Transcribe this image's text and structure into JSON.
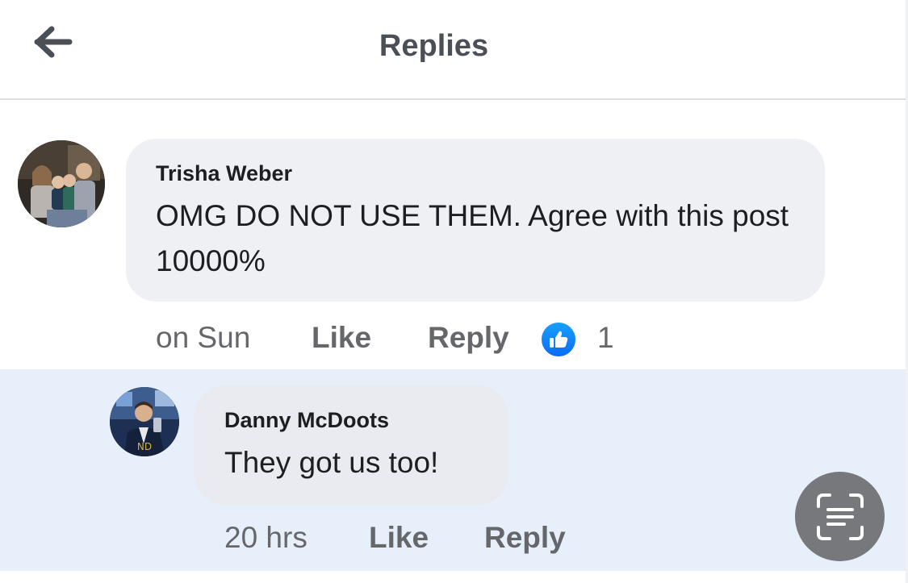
{
  "header": {
    "title": "Replies",
    "back_icon": "arrow-left-icon"
  },
  "comments": [
    {
      "author": "Trisha Weber",
      "text": "OMG DO NOT USE THEM. Agree with this post 10000%",
      "time": "on Sun",
      "like_label": "Like",
      "reply_label": "Reply",
      "reaction_icon": "thumbs-up-icon",
      "reaction_count": "1"
    },
    {
      "author": "Danny McDoots",
      "text": "They got us too!",
      "time": "20 hrs",
      "like_label": "Like",
      "reply_label": "Reply"
    }
  ],
  "floating_button": {
    "icon": "scan-text-icon"
  },
  "colors": {
    "accent": "#1877f2",
    "highlight_bg": "#e7effb",
    "bubble_bg": "#eff0f3",
    "fab_bg": "#76787c"
  }
}
